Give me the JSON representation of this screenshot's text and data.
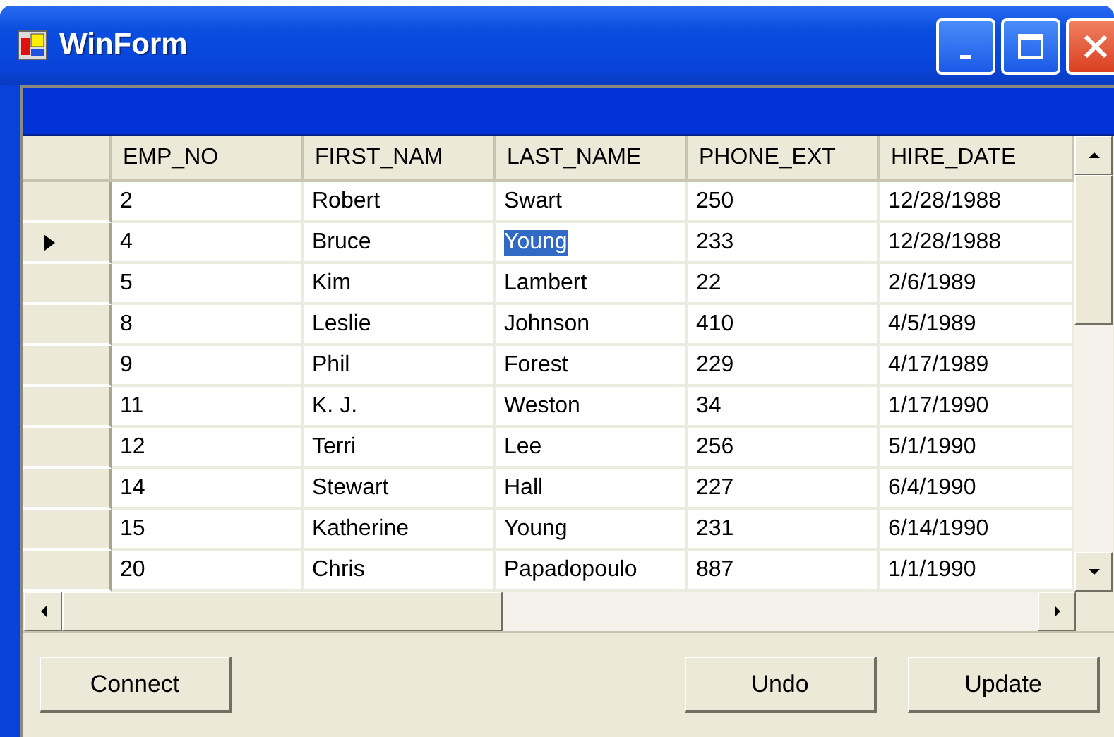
{
  "window": {
    "title": "WinForm"
  },
  "grid": {
    "columns": [
      "EMP_NO",
      "FIRST_NAM",
      "LAST_NAME",
      "PHONE_EXT",
      "HIRE_DATE"
    ],
    "rows": [
      {
        "current": false,
        "cells": [
          {
            "text": "2",
            "selected": false
          },
          {
            "text": "Robert",
            "selected": false
          },
          {
            "text": "Swart",
            "selected": false
          },
          {
            "text": "250",
            "selected": false
          },
          {
            "text": "12/28/1988",
            "selected": false
          }
        ]
      },
      {
        "current": true,
        "cells": [
          {
            "text": "4",
            "selected": false
          },
          {
            "text": "Bruce",
            "selected": false
          },
          {
            "text": "Young",
            "selected": true
          },
          {
            "text": "233",
            "selected": false
          },
          {
            "text": "12/28/1988",
            "selected": false
          }
        ]
      },
      {
        "current": false,
        "cells": [
          {
            "text": "5",
            "selected": false
          },
          {
            "text": "Kim",
            "selected": false
          },
          {
            "text": "Lambert",
            "selected": false
          },
          {
            "text": "22",
            "selected": false
          },
          {
            "text": "2/6/1989",
            "selected": false
          }
        ]
      },
      {
        "current": false,
        "cells": [
          {
            "text": "8",
            "selected": false
          },
          {
            "text": "Leslie",
            "selected": false
          },
          {
            "text": "Johnson",
            "selected": false
          },
          {
            "text": "410",
            "selected": false
          },
          {
            "text": "4/5/1989",
            "selected": false
          }
        ]
      },
      {
        "current": false,
        "cells": [
          {
            "text": "9",
            "selected": false
          },
          {
            "text": "Phil",
            "selected": false
          },
          {
            "text": "Forest",
            "selected": false
          },
          {
            "text": "229",
            "selected": false
          },
          {
            "text": "4/17/1989",
            "selected": false
          }
        ]
      },
      {
        "current": false,
        "cells": [
          {
            "text": "11",
            "selected": false
          },
          {
            "text": "K. J.",
            "selected": false
          },
          {
            "text": "Weston",
            "selected": false
          },
          {
            "text": "34",
            "selected": false
          },
          {
            "text": "1/17/1990",
            "selected": false
          }
        ]
      },
      {
        "current": false,
        "cells": [
          {
            "text": "12",
            "selected": false
          },
          {
            "text": "Terri",
            "selected": false
          },
          {
            "text": "Lee",
            "selected": false
          },
          {
            "text": "256",
            "selected": false
          },
          {
            "text": "5/1/1990",
            "selected": false
          }
        ]
      },
      {
        "current": false,
        "cells": [
          {
            "text": "14",
            "selected": false
          },
          {
            "text": "Stewart",
            "selected": false
          },
          {
            "text": "Hall",
            "selected": false
          },
          {
            "text": "227",
            "selected": false
          },
          {
            "text": "6/4/1990",
            "selected": false
          }
        ]
      },
      {
        "current": false,
        "cells": [
          {
            "text": "15",
            "selected": false
          },
          {
            "text": "Katherine",
            "selected": false
          },
          {
            "text": "Young",
            "selected": false
          },
          {
            "text": "231",
            "selected": false
          },
          {
            "text": "6/14/1990",
            "selected": false
          }
        ]
      },
      {
        "current": false,
        "cells": [
          {
            "text": "20",
            "selected": false
          },
          {
            "text": "Chris",
            "selected": false
          },
          {
            "text": "Papadopoulo",
            "selected": false
          },
          {
            "text": "887",
            "selected": false
          },
          {
            "text": "1/1/1990",
            "selected": false
          }
        ]
      }
    ]
  },
  "buttons": {
    "left": [
      "Connect"
    ],
    "right": [
      "Undo",
      "Update"
    ]
  }
}
